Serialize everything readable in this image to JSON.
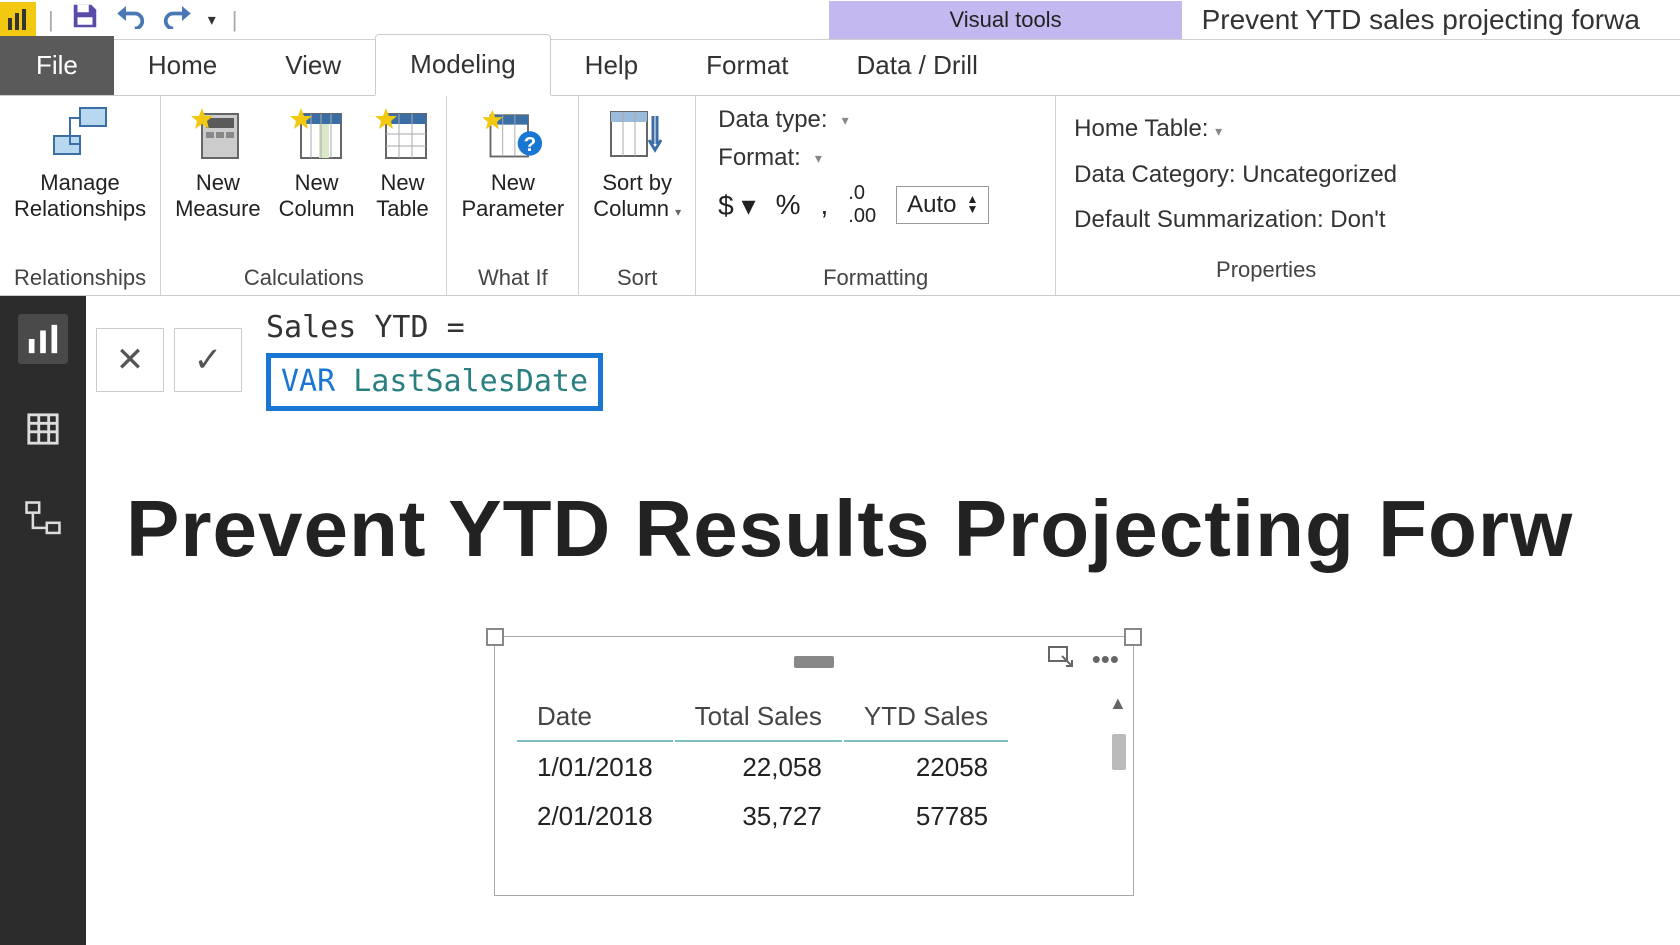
{
  "titlebar": {
    "visual_tools": "Visual tools",
    "document_title": "Prevent YTD sales projecting forwa"
  },
  "tabs": {
    "file": "File",
    "home": "Home",
    "view": "View",
    "modeling": "Modeling",
    "help": "Help",
    "format": "Format",
    "data_drill": "Data / Drill"
  },
  "ribbon": {
    "manage_relationships": "Manage\nRelationships",
    "relationships_group": "Relationships",
    "new_measure": "New\nMeasure",
    "new_column": "New\nColumn",
    "new_table": "New\nTable",
    "calculations_group": "Calculations",
    "new_parameter": "New\nParameter",
    "whatif_group": "What If",
    "sort_by_column": "Sort by\nColumn",
    "sort_group": "Sort",
    "data_type": "Data type:",
    "format_label": "Format:",
    "auto_value": "Auto",
    "formatting_group": "Formatting",
    "home_table": "Home Table:",
    "data_category": "Data Category: Uncategorized",
    "default_summarization": "Default Summarization: Don't",
    "properties_group": "Properties"
  },
  "formula": {
    "line1": "Sales YTD =",
    "var_kw": "VAR",
    "var_name": "LastSalesDate"
  },
  "report": {
    "title": "Prevent YTD Results Projecting Forw"
  },
  "table": {
    "headers": {
      "date": "Date",
      "total": "Total Sales",
      "ytd": "YTD Sales"
    },
    "rows": [
      {
        "date": "1/01/2018",
        "total": "22,058",
        "ytd": "22058"
      },
      {
        "date": "2/01/2018",
        "total": "35,727",
        "ytd": "57785"
      }
    ]
  }
}
